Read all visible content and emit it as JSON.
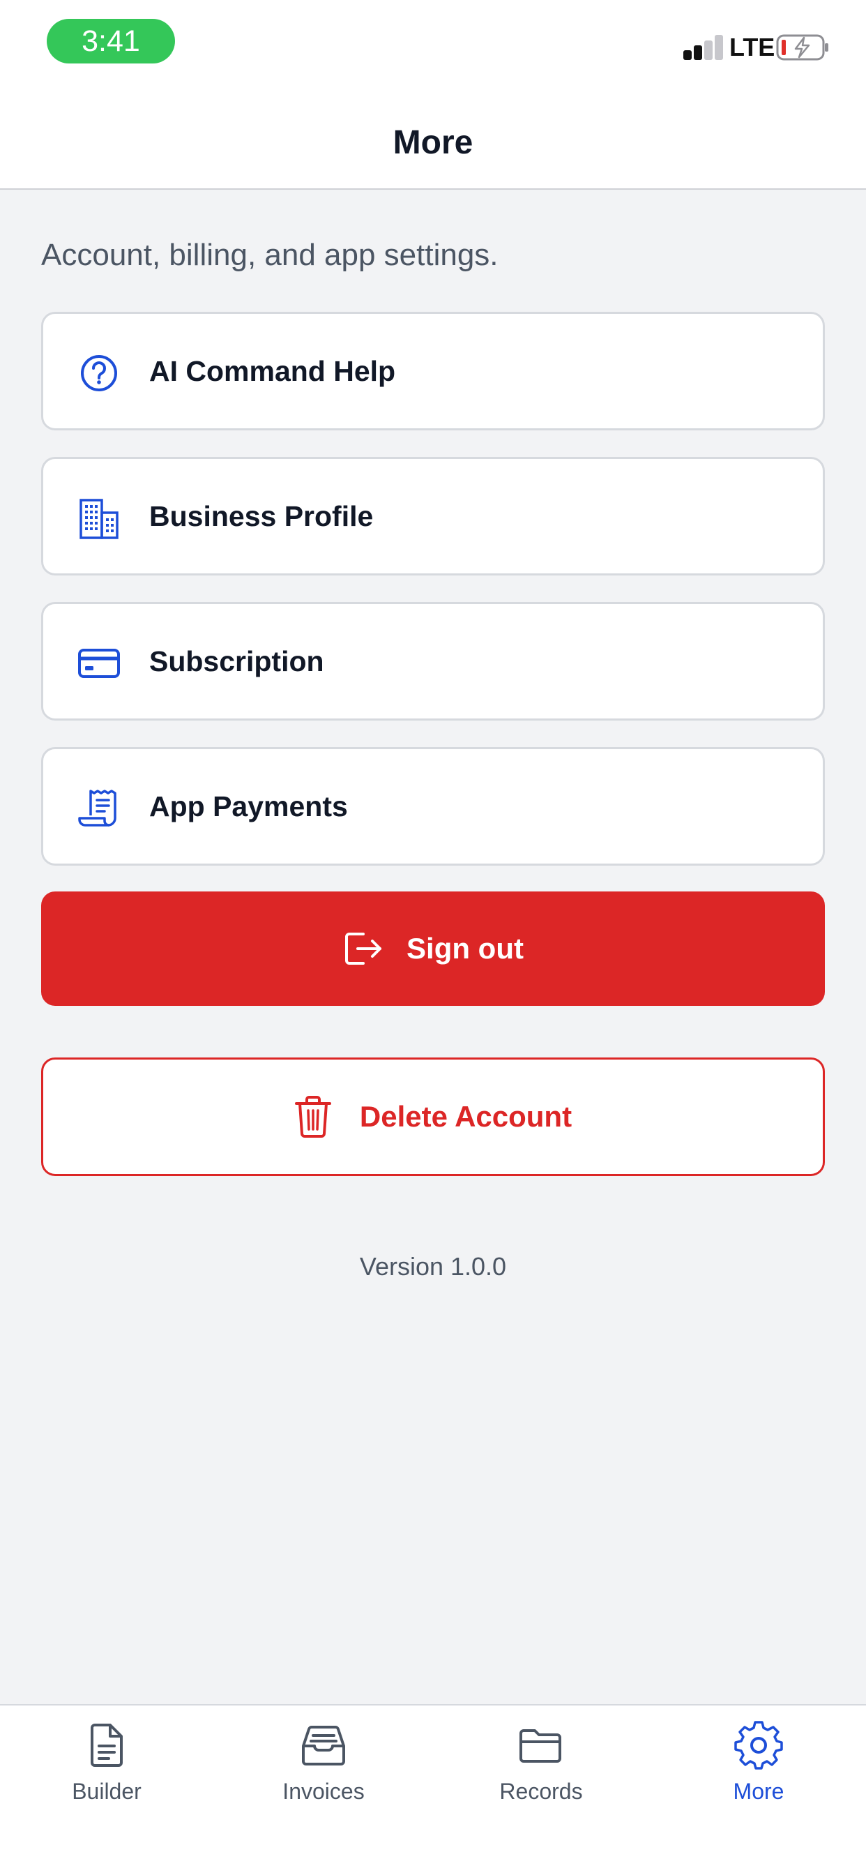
{
  "status_bar": {
    "time": "3:41",
    "network": "LTE",
    "signal_bars_active": 2,
    "signal_bars_total": 4
  },
  "header": {
    "title": "More"
  },
  "subtitle": "Account, billing, and app settings.",
  "menu": {
    "items": [
      {
        "label": "AI Command Help",
        "icon": "question-circle-icon"
      },
      {
        "label": "Business Profile",
        "icon": "building-icon"
      },
      {
        "label": "Subscription",
        "icon": "credit-card-icon"
      },
      {
        "label": "App Payments",
        "icon": "receipt-icon"
      }
    ]
  },
  "actions": {
    "sign_out_label": "Sign out",
    "delete_account_label": "Delete Account"
  },
  "footer": {
    "version": "Version 1.0.0"
  },
  "tabbar": {
    "tabs": [
      {
        "label": "Builder",
        "icon": "document-icon",
        "active": false
      },
      {
        "label": "Invoices",
        "icon": "inbox-tray-icon",
        "active": false
      },
      {
        "label": "Records",
        "icon": "folder-icon",
        "active": false
      },
      {
        "label": "More",
        "icon": "gear-icon",
        "active": true
      }
    ]
  },
  "colors": {
    "accent_blue": "#1d4ed8",
    "danger_red": "#dc2626",
    "status_green": "#34c759",
    "background": "#f2f3f5"
  }
}
